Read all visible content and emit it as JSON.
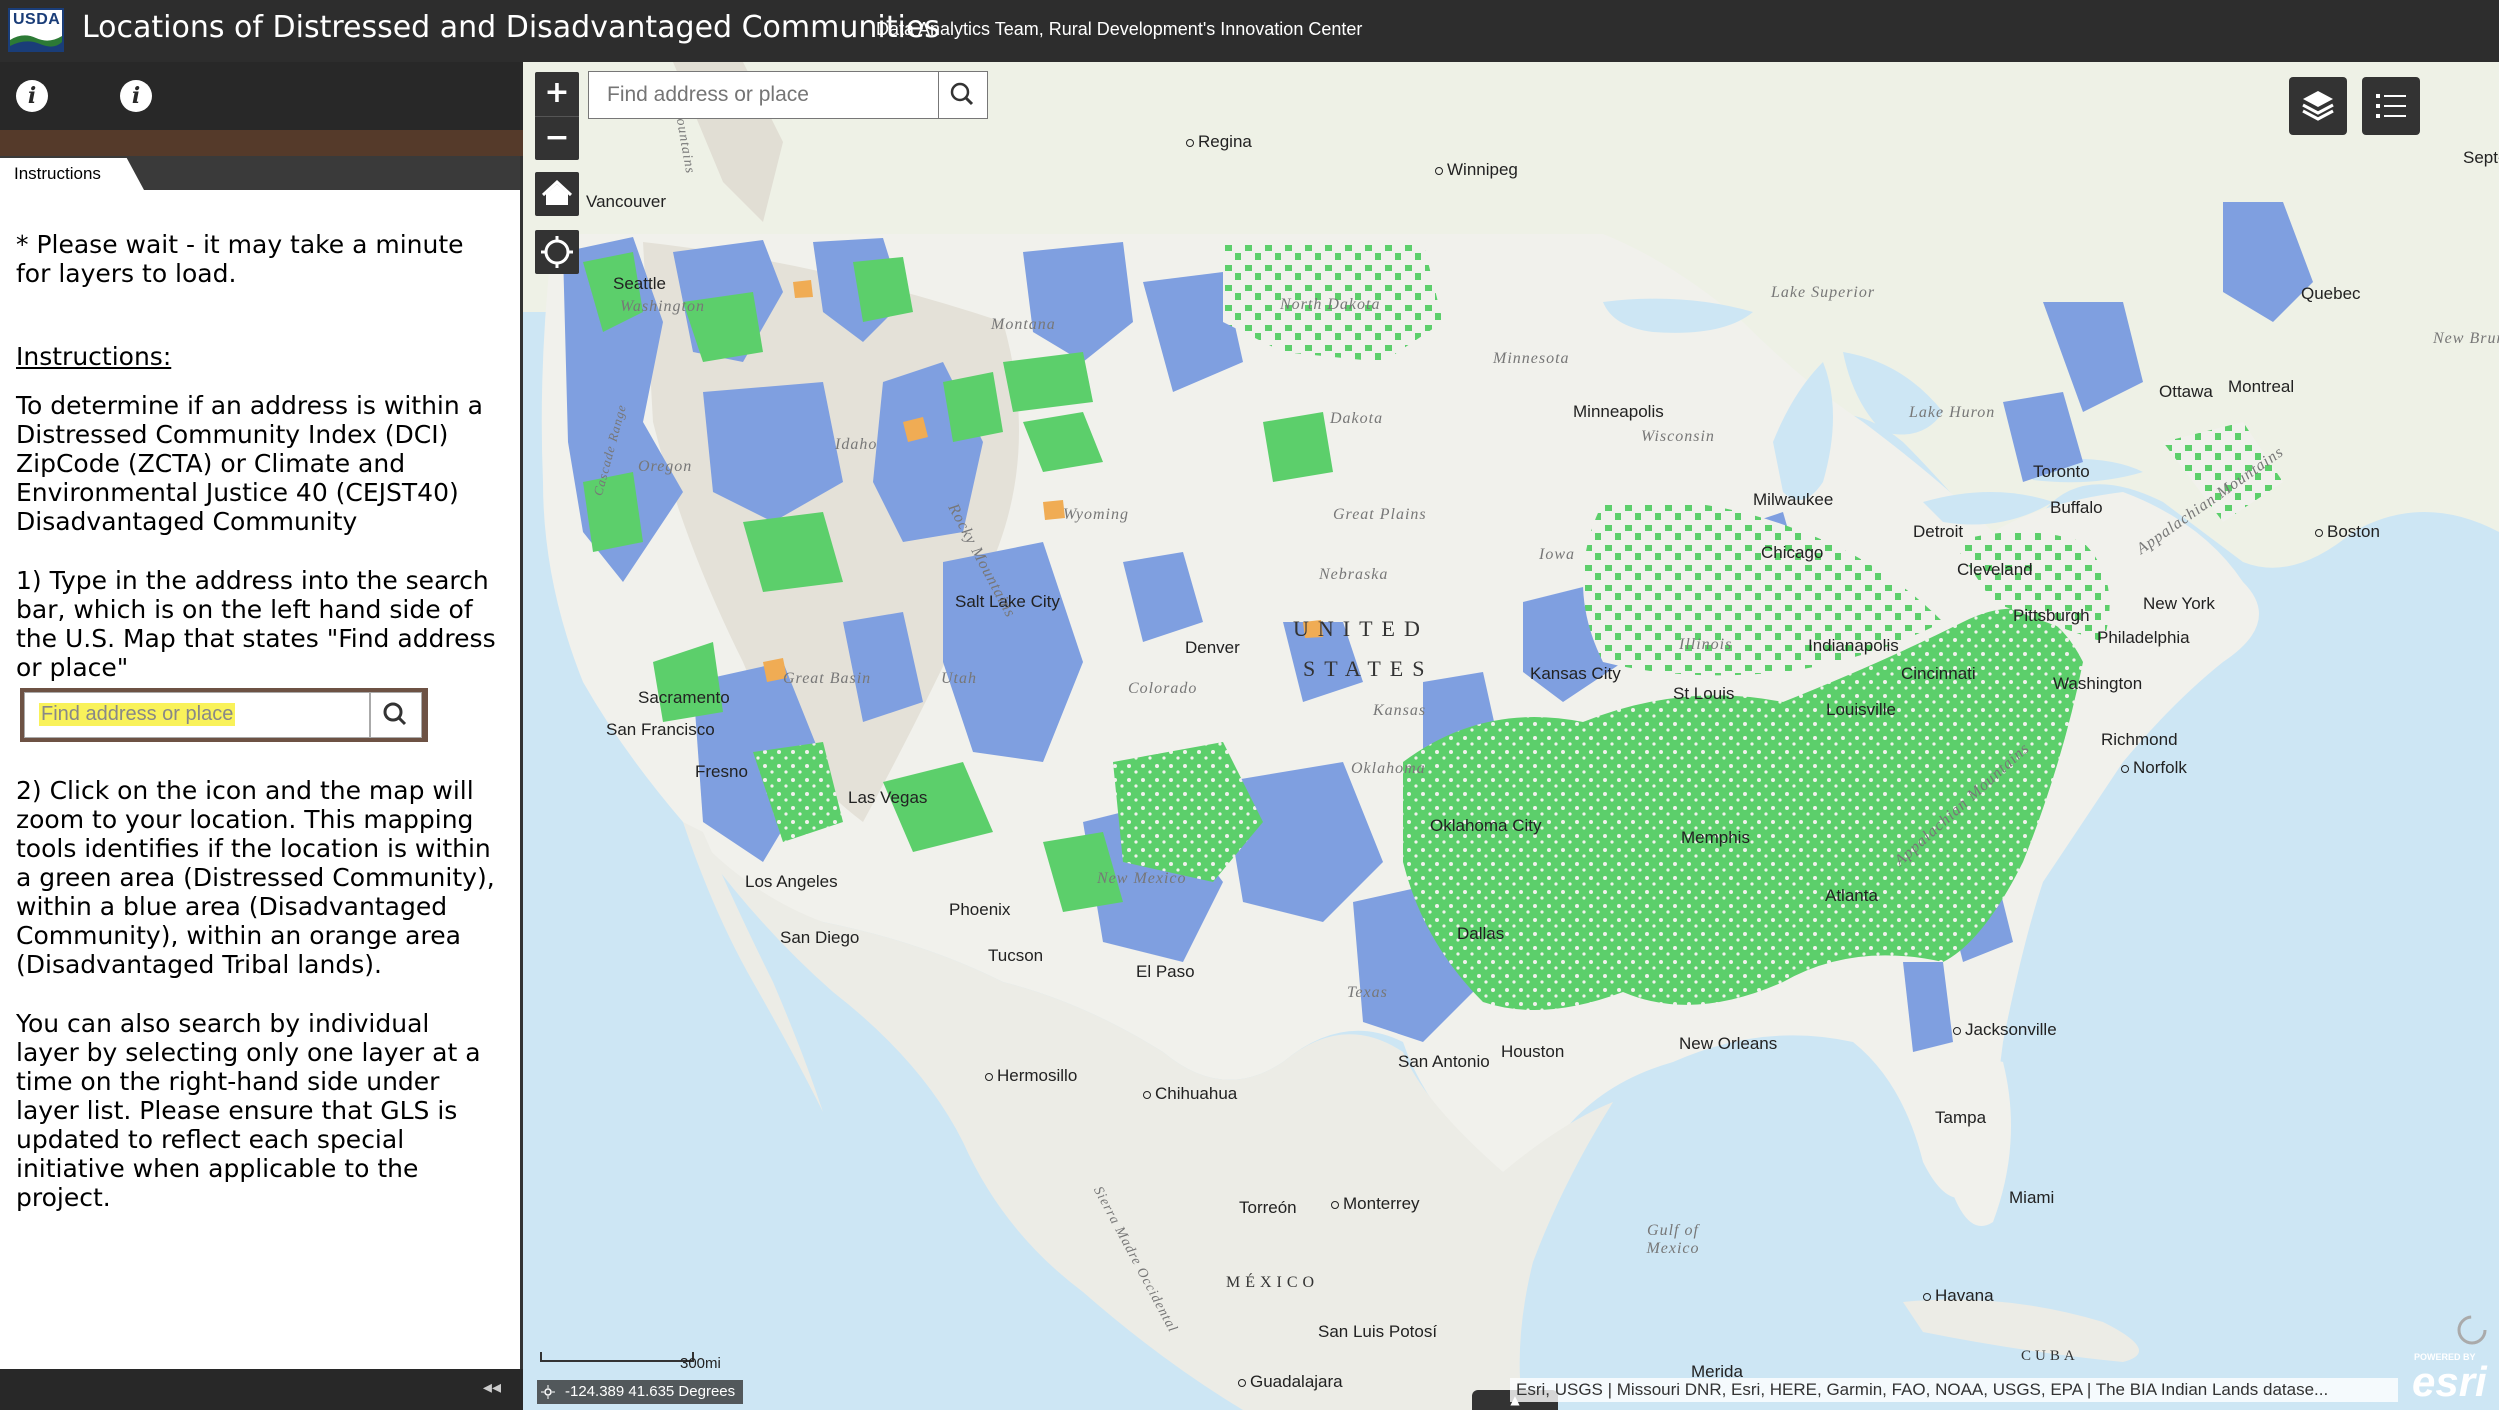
{
  "header": {
    "logo_text": "USDA",
    "title": "Locations of Distressed and Disadvantaged Communities",
    "subtitle": "Data Analytics Team, Rural Development's Innovation Center"
  },
  "panel": {
    "tab_label": "Instructions",
    "wait_note": "* Please wait - it may take a minute for layers to load.",
    "instructions_heading": "Instructions:",
    "intro": "To determine if an address is within a Distressed Community Index (DCI) ZipCode (ZCTA) or Climate and Environmental Justice 40 (CEJST40) Disadvantaged Community",
    "step1": "1) Type in the address into the search bar, which is on the left hand side of the U.S. Map that states \"Find address or place\"",
    "sample_search_text": "Find address or place",
    "step2": "2) Click on the icon and the map will zoom to your location.  This mapping tools identifies if the location is within a green area (Distressed Community), within a blue area (Disadvantaged Community), within an orange area (Disadvantaged Tribal lands).",
    "step3": "You can also search by individual layer by selecting only one layer at a time on the right-hand side under layer list. Please ensure that GLS is updated to reflect each special initiative when applicable to the project.",
    "collapse_icon": "double-chevron-left-icon"
  },
  "map": {
    "search_placeholder": "Find address or place",
    "zoom_in": "+",
    "zoom_out": "−",
    "scale_label": "300mi",
    "coordinates": "-124.389 41.635 Degrees",
    "attribution": "Esri, USGS | Missouri DNR, Esri, HERE, Garmin, FAO, NOAA, USGS, EPA | The BIA Indian Lands datase...",
    "esri_powered": "POWERED BY",
    "esri_brand": "esri",
    "colors": {
      "distressed": "#5ccf6b",
      "disadvantaged": "#7f9fe0",
      "tribal": "#f0ac54",
      "water": "#cde6f4",
      "land": "#f1f1ec"
    },
    "labels": {
      "regina": "Regina",
      "winnipeg": "Winnipeg",
      "vancouver": "Vancouver",
      "seattle": "Seattle",
      "washington": "Washington",
      "montana": "Montana",
      "north_dakota": "North Dakota",
      "minnesota": "Minnesota",
      "lake_superior": "Lake Superior",
      "quebec": "Quebec",
      "new_brunswick": "New Brunswick",
      "ottawa": "Ottawa",
      "montreal": "Montreal",
      "toronto": "Toronto",
      "buffalo": "Buffalo",
      "lake_huron": "Lake Huron",
      "minneapolis": "Minneapolis",
      "wisconsin": "Wisconsin",
      "dakota": "Dakota",
      "oregon": "Oregon",
      "idaho": "Idaho",
      "wyoming": "Wyoming",
      "great_plains": "Great Plains",
      "milwaukee": "Milwaukee",
      "detroit": "Detroit",
      "boston": "Boston",
      "chicago": "Chicago",
      "cleveland": "Cleveland",
      "iowa": "Iowa",
      "nebraska": "Nebraska",
      "pittsburgh": "Pittsburgh",
      "new_york": "New York",
      "salt_lake": "Salt Lake City",
      "denver": "Denver",
      "united": "UNITED",
      "states": "STATES",
      "philadelphia": "Philadelphia",
      "indianapolis": "Indianapolis",
      "illinois": "Illinois",
      "sacramento": "Sacramento",
      "san_francisco": "San Francisco",
      "great_basin": "Great Basin",
      "utah": "Utah",
      "colorado": "Colorado",
      "kansas_city": "Kansas City",
      "st_louis": "St Louis",
      "cincinnati": "Cincinnati",
      "washington_dc": "Washington",
      "kansas": "Kansas",
      "louisville": "Louisville",
      "richmond": "Richmond",
      "norfolk": "Norfolk",
      "fresno": "Fresno",
      "las_vegas": "Las Vegas",
      "oklahoma": "Oklahoma",
      "oklahoma_city": "Oklahoma City",
      "memphis": "Memphis",
      "appalachian": "Appalachian Mountains",
      "los_angeles": "Los Angeles",
      "new_mexico": "New Mexico",
      "atlanta": "Atlanta",
      "san_diego": "San Diego",
      "phoenix": "Phoenix",
      "dallas": "Dallas",
      "tucson": "Tucson",
      "el_paso": "El Paso",
      "texas": "Texas",
      "jacksonville": "Jacksonville",
      "new_orleans": "New Orleans",
      "san_antonio": "San Antonio",
      "houston": "Houston",
      "hermosillo": "Hermosillo",
      "chihuahua": "Chihuahua",
      "tampa": "Tampa",
      "miami": "Miami",
      "torreon": "Torreón",
      "monterrey": "Monterrey",
      "gulf_of_mexico": "Gulf of Mexico",
      "mexico": "MÉXICO",
      "sierra_madre": "Sierra Madre Occidental",
      "havana": "Havana",
      "san_luis": "San Luis Potosí",
      "cuba": "CUBA",
      "guadalajara": "Guadalajara",
      "merida": "Merida",
      "rocky_mountains": "Rocky Mountains",
      "cascade": "Cascade Range",
      "mountains": "Mountains",
      "sept": "Sept-"
    }
  }
}
